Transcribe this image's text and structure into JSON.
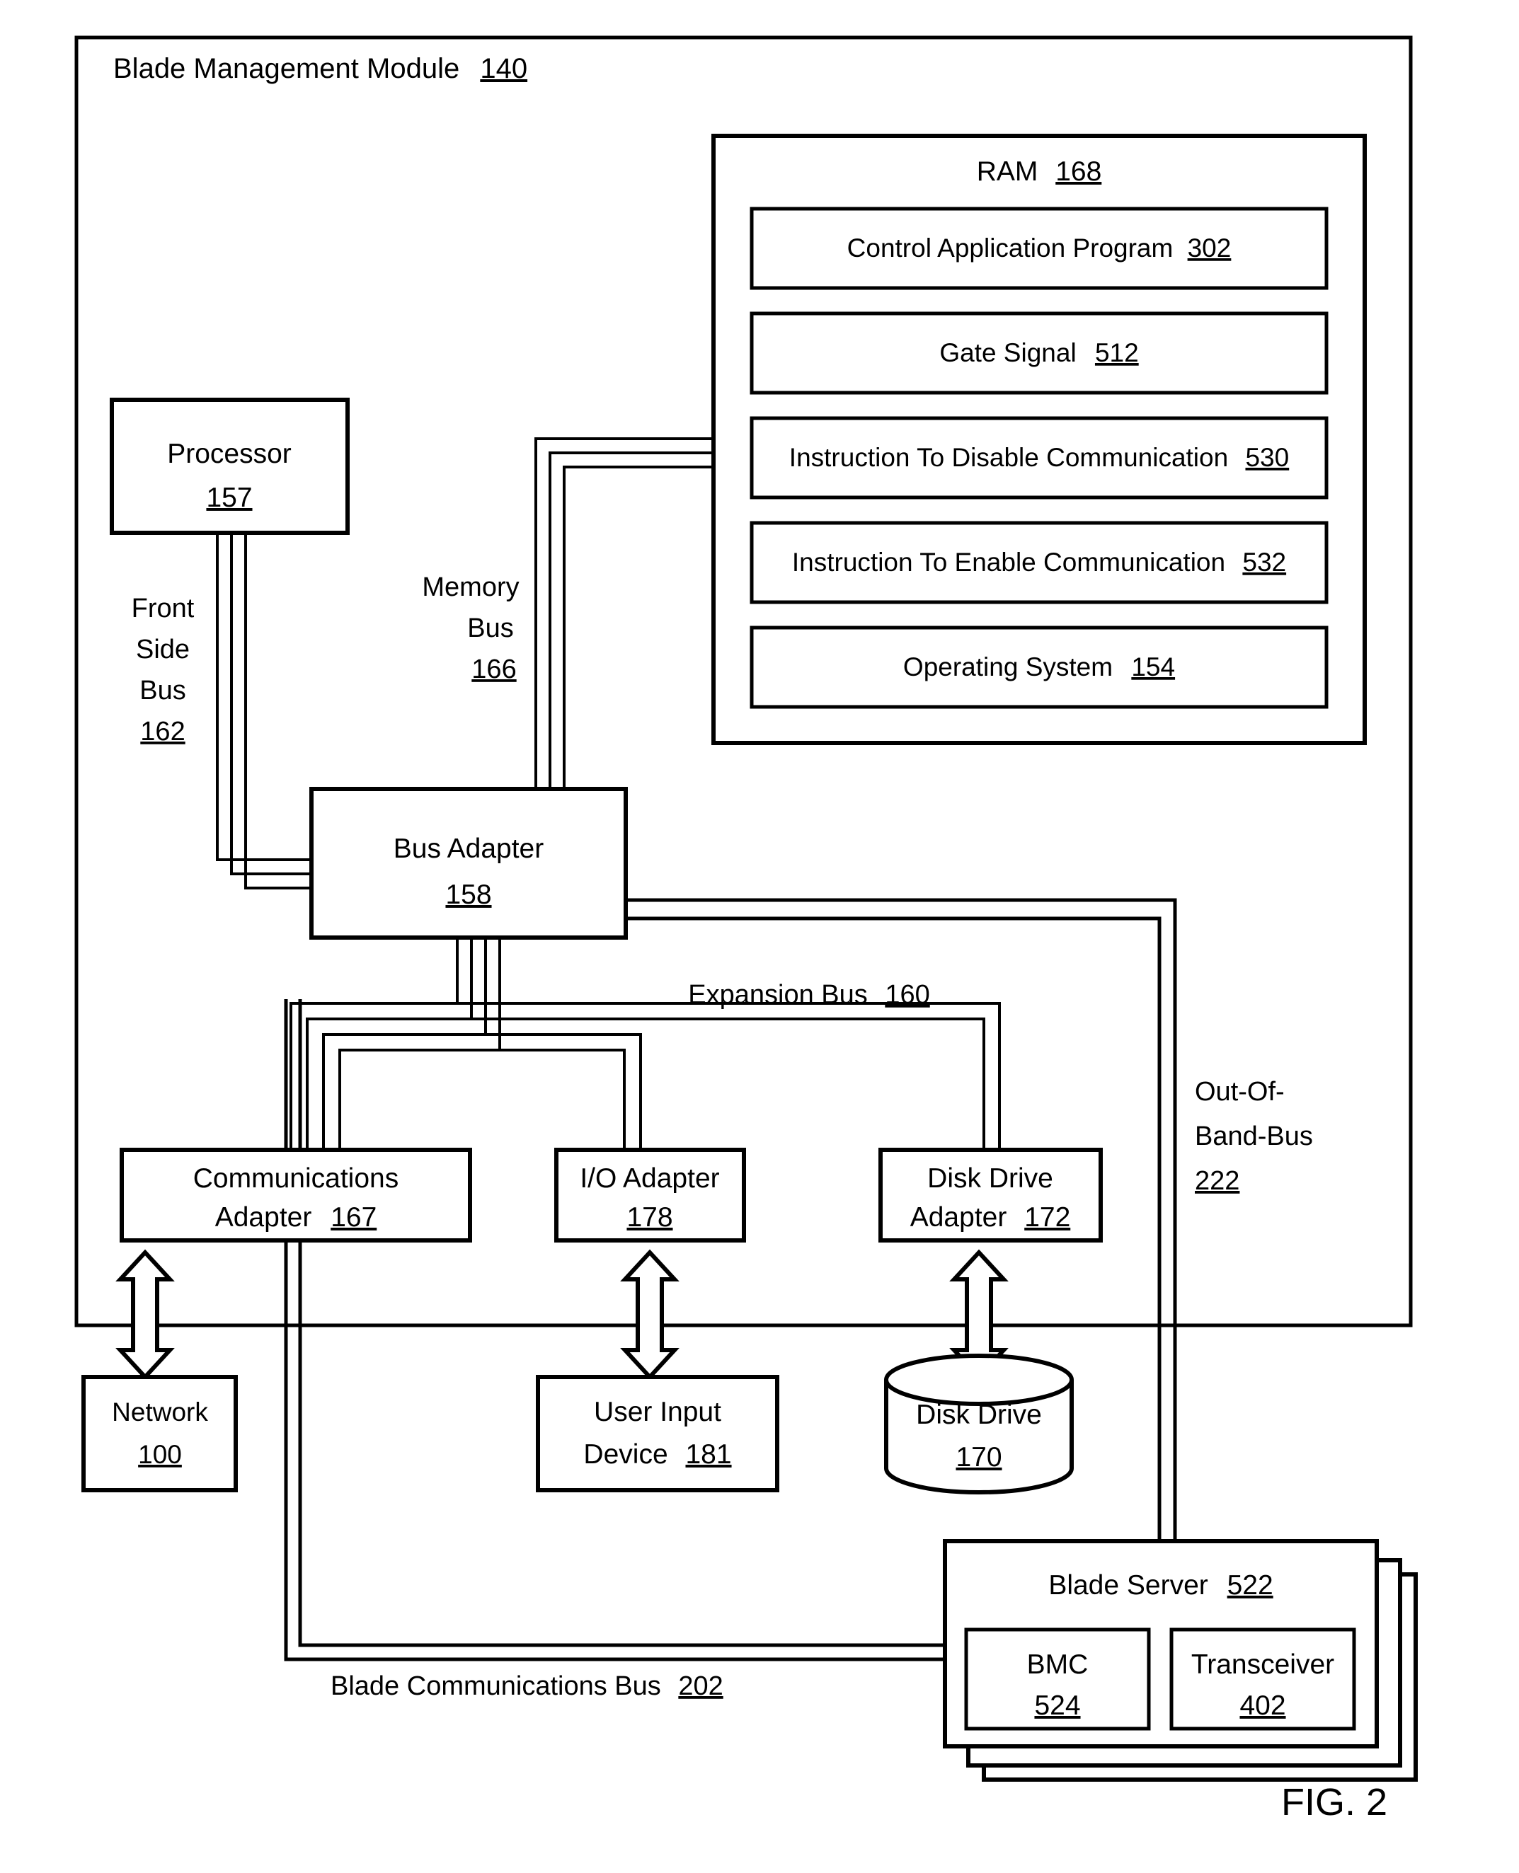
{
  "figure": {
    "caption": "FIG. 2",
    "module_title": "Blade Management Module",
    "module_ref": "140"
  },
  "ram": {
    "title": "RAM",
    "ref": "168",
    "items": [
      {
        "label": "Control Application Program",
        "ref": "302"
      },
      {
        "label": "Gate Signal",
        "ref": "512"
      },
      {
        "label": "Instruction To Disable Communication",
        "ref": "530"
      },
      {
        "label": "Instruction To Enable Communication",
        "ref": "532"
      },
      {
        "label": "Operating System",
        "ref": "154"
      }
    ]
  },
  "processor": {
    "label": "Processor",
    "ref": "157"
  },
  "bus_adapter": {
    "label": "Bus Adapter",
    "ref": "158"
  },
  "buses": {
    "front_side": {
      "line1": "Front",
      "line2": "Side",
      "line3": "Bus",
      "ref": "162"
    },
    "memory": {
      "line1": "Memory",
      "line2": "Bus",
      "ref": "166"
    },
    "expansion": {
      "label": "Expansion Bus",
      "ref": "160"
    },
    "out_of_band": {
      "line1": "Out-Of-",
      "line2": "Band-Bus",
      "ref": "222"
    },
    "blade_communications": {
      "label": "Blade Communications Bus",
      "ref": "202"
    }
  },
  "adapters": {
    "communications": {
      "line1": "Communications",
      "line2": "Adapter",
      "ref": "167"
    },
    "io": {
      "line1": "I/O Adapter",
      "ref": "178"
    },
    "disk_drive": {
      "line1": "Disk Drive",
      "line2": "Adapter",
      "ref": "172"
    }
  },
  "peripherals": {
    "network": {
      "label": "Network",
      "ref": "100"
    },
    "user_input": {
      "line1": "User Input",
      "line2": "Device",
      "ref": "181"
    },
    "disk_drive": {
      "label": "Disk Drive",
      "ref": "170"
    }
  },
  "blade_server": {
    "title": "Blade Server",
    "ref": "522",
    "bmc": {
      "label": "BMC",
      "ref": "524"
    },
    "transceiver": {
      "label": "Transceiver",
      "ref": "402"
    }
  }
}
